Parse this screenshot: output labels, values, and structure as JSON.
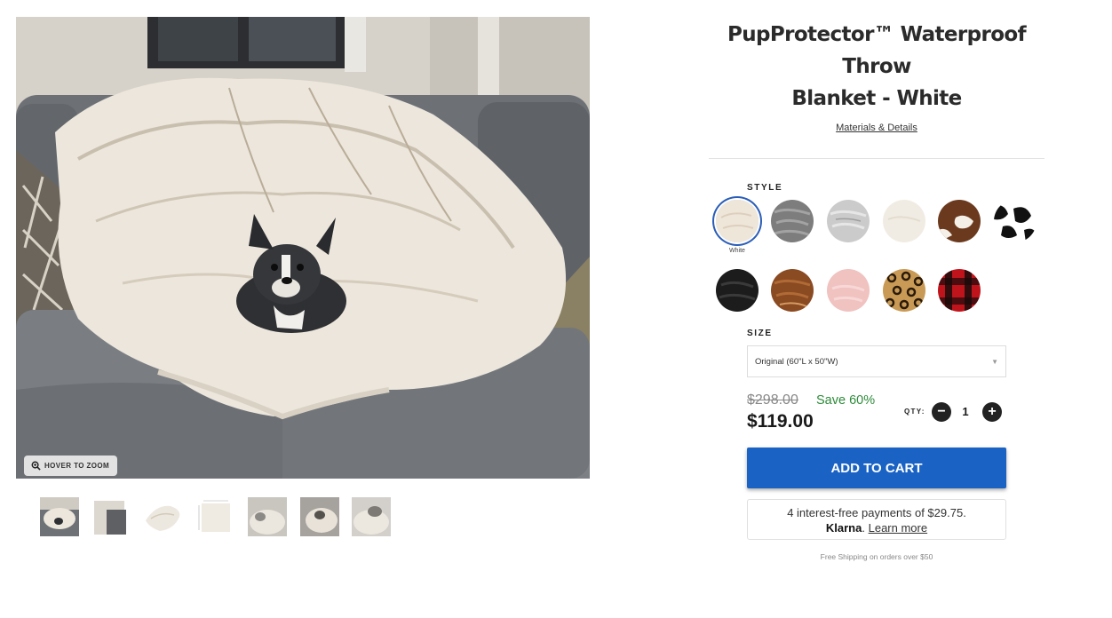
{
  "gallery": {
    "zoom_label": "HOVER TO ZOOM",
    "thumbnail_count": 7
  },
  "product": {
    "title_line1": "PupProtector™ Waterproof Throw",
    "title_line2": "Blanket - White",
    "materials_link": "Materials & Details"
  },
  "style": {
    "label": "STYLE",
    "selected_caption": "White",
    "swatches": [
      {
        "name": "White",
        "color": "#efe6da"
      },
      {
        "name": "Gray",
        "color": "#7d7d7d"
      },
      {
        "name": "Light Gray",
        "color": "#c9c9c9"
      },
      {
        "name": "Cream",
        "color": "#f1ece3"
      },
      {
        "name": "Brown Cowhide",
        "color": "#6b3a1e"
      },
      {
        "name": "Black Cowhide",
        "color": "#111111"
      },
      {
        "name": "Black",
        "color": "#1c1c1c"
      },
      {
        "name": "Brown",
        "color": "#8a4a22"
      },
      {
        "name": "Pink",
        "color": "#f0c2c0"
      },
      {
        "name": "Leopard",
        "color": "#b88d4a"
      },
      {
        "name": "Red Plaid",
        "color": "#c0141c"
      }
    ]
  },
  "size": {
    "label": "SIZE",
    "selected": "Original (60\"L x 50\"W)"
  },
  "pricing": {
    "compare_price": "$298.00",
    "save_text": "Save 60%",
    "price": "$119.00"
  },
  "quantity": {
    "label": "QTY:",
    "value": "1",
    "minus": "−",
    "plus": "+"
  },
  "cart": {
    "button_label": "ADD TO CART"
  },
  "klarna": {
    "line1": "4 interest-free payments of $29.75.",
    "brand": "Klarna",
    "separator": ".",
    "learn_more": "Learn more"
  },
  "shipping_note": "Free Shipping on orders over $50",
  "colors": {
    "accent_blue": "#1a62c4",
    "save_green": "#2e8b3a",
    "selected_ring": "#2a5db8"
  }
}
